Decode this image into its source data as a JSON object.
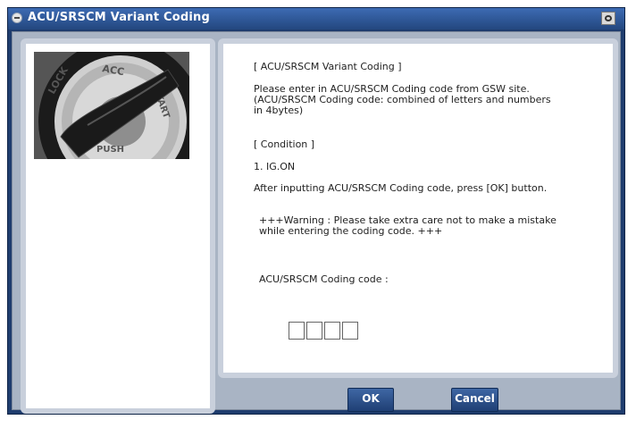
{
  "window": {
    "title": "ACU/SRSCM Variant Coding",
    "title_icon": "circle-icon",
    "capture_icon": "camera-icon"
  },
  "photo": {
    "ring_labels": [
      "LOCK",
      "ACC",
      "START",
      "PUSH"
    ]
  },
  "instructions": {
    "heading": "[ ACU/SRSCM Variant Coding ]",
    "description": "Please enter in  ACU/SRSCM Coding code from GSW site.\n(ACU/SRSCM Coding code: combined of letters and numbers\n in 4bytes)",
    "condition_heading": "[ Condition ]",
    "condition_1": "1. IG.ON",
    "after_input": "After inputting ACU/SRSCM Coding code, press [OK] button.",
    "warning": "+++Warning : Please take extra care not to make a mistake\n            while entering the coding code. +++"
  },
  "code": {
    "label": "ACU/SRSCM Coding code :",
    "values": [
      "",
      "",
      "",
      ""
    ]
  },
  "buttons": {
    "ok": "OK",
    "cancel": "Cancel"
  },
  "colors": {
    "title_bar": "#2f5696",
    "frame": "#1f3d6e",
    "panel_border": "#c9d0dc",
    "button": "#2c5089"
  }
}
